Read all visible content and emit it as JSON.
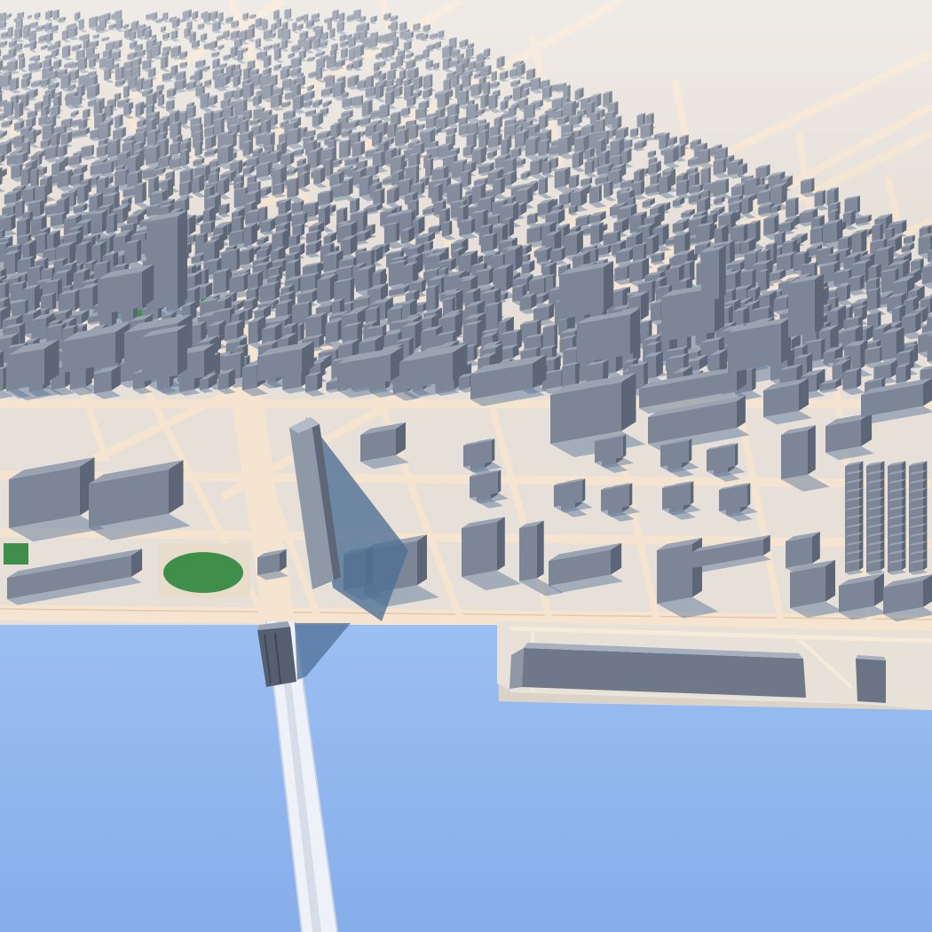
{
  "scene": {
    "kind": "3d-city-model-render",
    "palette": {
      "water": "#8eb6ef",
      "water_deep": "#7ea9e8",
      "ground": "#e6e0d8",
      "road": "#f4e4d0",
      "road_edge": "#e6c8a8",
      "building_top": "#9aa3b2",
      "building_left": "#7d8697",
      "building_right": "#5d6676",
      "shadow": "#4f6f95",
      "park": "#3f8f4a",
      "bridge": "#eef2f8"
    },
    "features": [
      "river",
      "bridge",
      "riverfront-promenade",
      "sports-field",
      "tall-tower",
      "cross-shaped-towers",
      "row-houses",
      "waterfront-warehouse",
      "dense-downtown-grid"
    ]
  }
}
